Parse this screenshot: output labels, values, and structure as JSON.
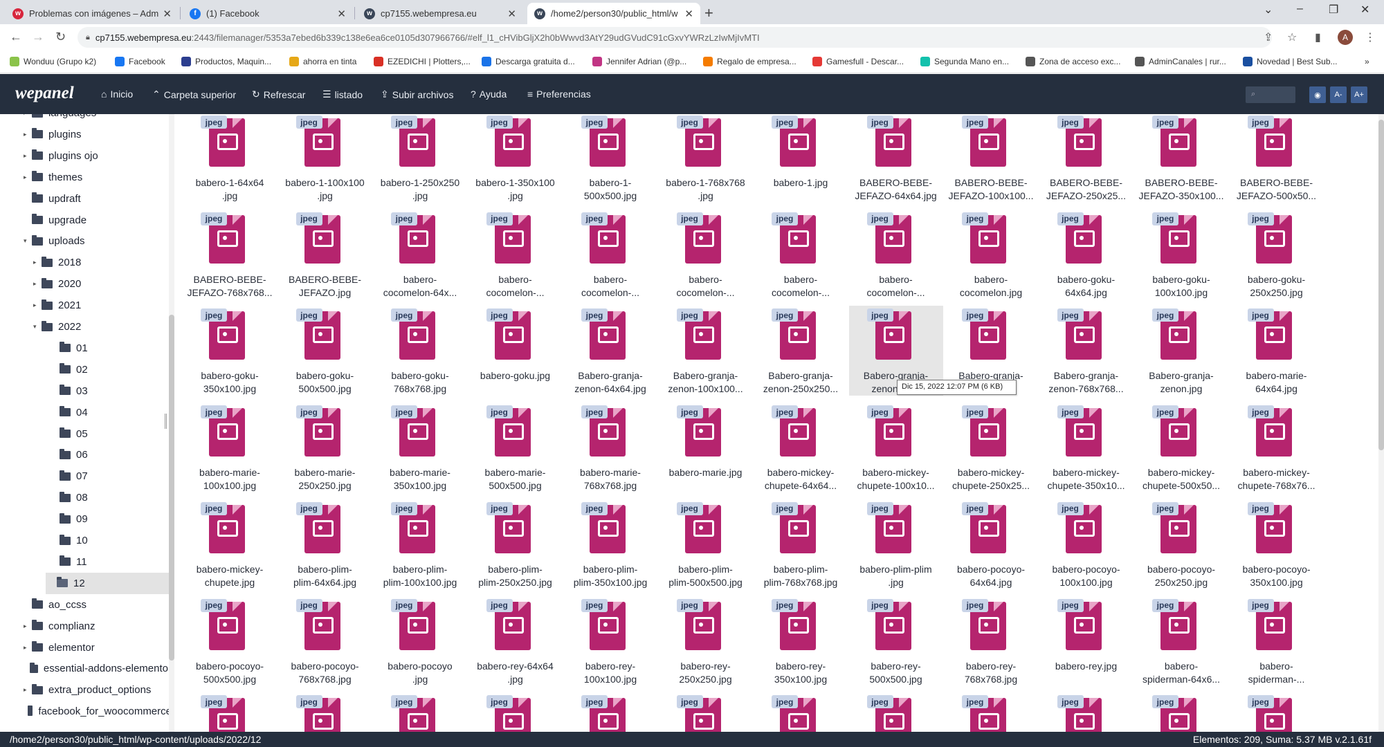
{
  "browser": {
    "tabs": [
      {
        "label": "Problemas con imágenes – Adm",
        "favicon": "webempresa-icon",
        "color": "#d7263d",
        "active": false
      },
      {
        "label": "(1) Facebook",
        "favicon": "facebook-icon",
        "color": "#1877f2",
        "active": false
      },
      {
        "label": "cp7155.webempresa.eu",
        "favicon": "webempresa-icon",
        "color": "#3a4658",
        "active": false
      },
      {
        "label": "/home2/person30/public_html/w",
        "favicon": "webempresa-icon",
        "color": "#3a4658",
        "active": true
      }
    ],
    "url_host": "cp7155.webempresa.eu",
    "url_rest": ":2443/filemanager/5353a7ebed6b339c138e6ea6ce0105d307966766/#elf_l1_cHVibGljX2h0bWwvd3AtY29udGVudC91cGxvYWRzLzIwMjIvMTI",
    "profile_initial": "A",
    "bookmarks": [
      {
        "label": "Wonduu (Grupo k2)",
        "color": "#8bc34a"
      },
      {
        "label": "Facebook",
        "color": "#1877f2"
      },
      {
        "label": "Productos, Maquin...",
        "color": "#2c3e8f"
      },
      {
        "label": "ahorra en tinta",
        "color": "#e6a817"
      },
      {
        "label": "EZEDICHI | Plotters,...",
        "color": "#d93025"
      },
      {
        "label": "Descarga gratuita d...",
        "color": "#1a73e8"
      },
      {
        "label": "Jennifer Adrian (@p...",
        "color": "#c13584"
      },
      {
        "label": "Regalo de empresa...",
        "color": "#f57c00"
      },
      {
        "label": "Gamesfull - Descar...",
        "color": "#e53935"
      },
      {
        "label": "Segunda Mano en...",
        "color": "#13c1ac"
      },
      {
        "label": "Zona de acceso exc...",
        "color": "#555555"
      },
      {
        "label": "AdminCanales | rur...",
        "color": "#555555"
      },
      {
        "label": "Novedad | Best Sub...",
        "color": "#1a4fa0"
      }
    ]
  },
  "toolbar": {
    "logo": "wepanel",
    "buttons": [
      {
        "label": "Inicio",
        "icon": "home-icon",
        "glyph": "⌂"
      },
      {
        "label": "Carpeta superior",
        "icon": "chevron-up-icon",
        "glyph": "⌃"
      },
      {
        "label": "Refrescar",
        "icon": "refresh-icon",
        "glyph": "↻"
      },
      {
        "label": "listado",
        "icon": "list-icon",
        "glyph": "☰"
      },
      {
        "label": "Subir archivos",
        "icon": "upload-icon",
        "glyph": "⇪"
      },
      {
        "label": "Ayuda",
        "icon": "help-icon",
        "glyph": "?"
      },
      {
        "label": "Preferencias",
        "icon": "sliders-icon",
        "glyph": "≡"
      }
    ],
    "right_buttons": [
      {
        "label": "◉",
        "icon": "eye-icon"
      },
      {
        "label": "A-",
        "icon": "font-decrease-icon"
      },
      {
        "label": "A+",
        "icon": "font-increase-icon"
      }
    ]
  },
  "sidebar": {
    "items": [
      {
        "label": "languages",
        "level": 1,
        "caret": "▸"
      },
      {
        "label": "plugins",
        "level": 1,
        "caret": "▸"
      },
      {
        "label": "plugins ojo",
        "level": 1,
        "caret": "▸"
      },
      {
        "label": "themes",
        "level": 1,
        "caret": "▸"
      },
      {
        "label": "updraft",
        "level": 1,
        "caret": ""
      },
      {
        "label": "upgrade",
        "level": 1,
        "caret": ""
      },
      {
        "label": "uploads",
        "level": 1,
        "caret": "▾"
      },
      {
        "label": "2018",
        "level": 2,
        "caret": "▸"
      },
      {
        "label": "2020",
        "level": 2,
        "caret": "▸"
      },
      {
        "label": "2021",
        "level": 2,
        "caret": "▸"
      },
      {
        "label": "2022",
        "level": 2,
        "caret": "▾"
      },
      {
        "label": "01",
        "level": 3,
        "caret": ""
      },
      {
        "label": "02",
        "level": 3,
        "caret": ""
      },
      {
        "label": "03",
        "level": 3,
        "caret": ""
      },
      {
        "label": "04",
        "level": 3,
        "caret": ""
      },
      {
        "label": "05",
        "level": 3,
        "caret": ""
      },
      {
        "label": "06",
        "level": 3,
        "caret": ""
      },
      {
        "label": "07",
        "level": 3,
        "caret": ""
      },
      {
        "label": "08",
        "level": 3,
        "caret": ""
      },
      {
        "label": "09",
        "level": 3,
        "caret": ""
      },
      {
        "label": "10",
        "level": 3,
        "caret": ""
      },
      {
        "label": "11",
        "level": 3,
        "caret": ""
      },
      {
        "label": "12",
        "level": 3,
        "caret": "",
        "selected": true
      },
      {
        "label": "ao_ccss",
        "level": 1,
        "caret": ""
      },
      {
        "label": "complianz",
        "level": 1,
        "caret": "▸"
      },
      {
        "label": "elementor",
        "level": 1,
        "caret": "▸"
      },
      {
        "label": "essential-addons-elementor",
        "level": 1,
        "caret": ""
      },
      {
        "label": "extra_product_options",
        "level": 1,
        "caret": "▸"
      },
      {
        "label": "facebook_for_woocommerce",
        "level": 1,
        "caret": ""
      }
    ]
  },
  "files": {
    "type_badge": "jpeg",
    "items": [
      "babero-1-64x64\n.jpg",
      "babero-1-100x100\n.jpg",
      "babero-1-250x250\n.jpg",
      "babero-1-350x100\n.jpg",
      "babero-1-\n500x500.jpg",
      "babero-1-768x768\n.jpg",
      "babero-1.jpg",
      "BABERO-BEBE-\nJEFAZO-64x64.jpg",
      "BABERO-BEBE-\nJEFAZO-100x100...",
      "BABERO-BEBE-\nJEFAZO-250x25...",
      "BABERO-BEBE-\nJEFAZO-350x100...",
      "BABERO-BEBE-\nJEFAZO-500x50...",
      "BABERO-BEBE-\nJEFAZO-768x768...",
      "BABERO-BEBE-\nJEFAZO.jpg",
      "babero-\ncocomelon-64x...",
      "babero-\ncocomelon-...",
      "babero-\ncocomelon-...",
      "babero-\ncocomelon-...",
      "babero-\ncocomelon-...",
      "babero-\ncocomelon-...",
      "babero-\ncocomelon.jpg",
      "babero-goku-\n64x64.jpg",
      "babero-goku-\n100x100.jpg",
      "babero-goku-\n250x250.jpg",
      "babero-goku-\n350x100.jpg",
      "babero-goku-\n500x500.jpg",
      "babero-goku-\n768x768.jpg",
      "babero-goku.jpg",
      "Babero-granja-\nzenon-64x64.jpg",
      "Babero-granja-\nzenon-100x100...",
      "Babero-granja-\nzenon-250x250...",
      "Babero-granja-\nzenon-35...",
      "Babero-granja-\nzenon-50...",
      "Babero-granja-\nzenon-768x768...",
      "Babero-granja-\nzenon.jpg",
      "babero-marie-\n64x64.jpg",
      "babero-marie-\n100x100.jpg",
      "babero-marie-\n250x250.jpg",
      "babero-marie-\n350x100.jpg",
      "babero-marie-\n500x500.jpg",
      "babero-marie-\n768x768.jpg",
      "babero-marie.jpg",
      "babero-mickey-\nchupete-64x64...",
      "babero-mickey-\nchupete-100x10...",
      "babero-mickey-\nchupete-250x25...",
      "babero-mickey-\nchupete-350x10...",
      "babero-mickey-\nchupete-500x50...",
      "babero-mickey-\nchupete-768x76...",
      "babero-mickey-\nchupete.jpg",
      "babero-plim-\nplim-64x64.jpg",
      "babero-plim-\nplim-100x100.jpg",
      "babero-plim-\nplim-250x250.jpg",
      "babero-plim-\nplim-350x100.jpg",
      "babero-plim-\nplim-500x500.jpg",
      "babero-plim-\nplim-768x768.jpg",
      "babero-plim-plim\n.jpg",
      "babero-pocoyo-\n64x64.jpg",
      "babero-pocoyo-\n100x100.jpg",
      "babero-pocoyo-\n250x250.jpg",
      "babero-pocoyo-\n350x100.jpg",
      "babero-pocoyo-\n500x500.jpg",
      "babero-pocoyo-\n768x768.jpg",
      "babero-pocoyo\n.jpg",
      "babero-rey-64x64\n.jpg",
      "babero-rey-\n100x100.jpg",
      "babero-rey-\n250x250.jpg",
      "babero-rey-\n350x100.jpg",
      "babero-rey-\n500x500.jpg",
      "babero-rey-\n768x768.jpg",
      "babero-rey.jpg",
      "babero-\nspiderman-64x6...",
      "babero-\nspiderman-...",
      "",
      "",
      "",
      "",
      "",
      "",
      "",
      "",
      "",
      "",
      "",
      ""
    ],
    "hover_index": 31,
    "tooltip": "Dic 15, 2022 12:07 PM (6 KB)"
  },
  "status": {
    "path": "/home2/person30/public_html/wp-content/uploads/2022/12",
    "summary": "Elementos: 209, Suma: 5.37 MB v.2.1.61f"
  }
}
